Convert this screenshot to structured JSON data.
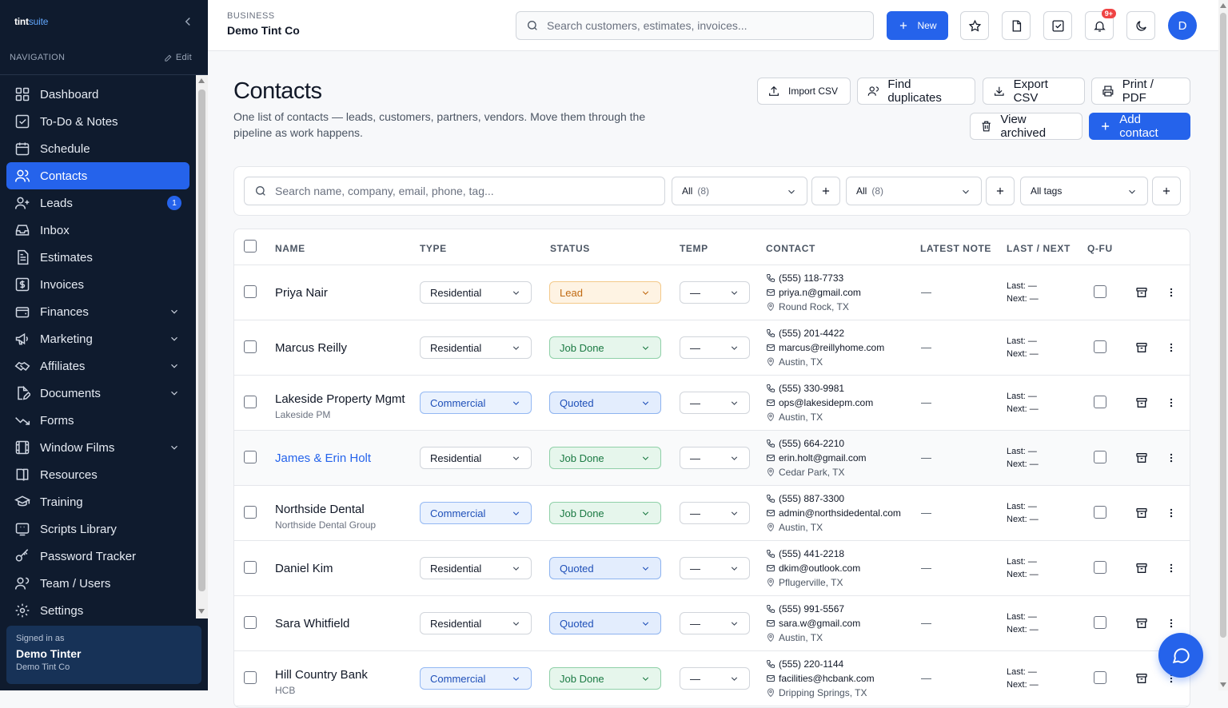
{
  "app": {
    "logo_main": "tint",
    "logo_accent": "suite"
  },
  "sidebar": {
    "nav_heading": "NAVIGATION",
    "edit_label": "Edit",
    "items": [
      {
        "label": "Dashboard",
        "icon": "dashboard-icon"
      },
      {
        "label": "To-Do & Notes",
        "icon": "checkbox-icon"
      },
      {
        "label": "Schedule",
        "icon": "calendar-icon"
      },
      {
        "label": "Contacts",
        "icon": "users-icon",
        "active": true
      },
      {
        "label": "Leads",
        "icon": "user-plus-icon",
        "badge": "1"
      },
      {
        "label": "Inbox",
        "icon": "inbox-icon"
      },
      {
        "label": "Estimates",
        "icon": "document-icon"
      },
      {
        "label": "Invoices",
        "icon": "dollar-icon"
      },
      {
        "label": "Finances",
        "icon": "wallet-icon",
        "expandable": true
      },
      {
        "label": "Marketing",
        "icon": "megaphone-icon",
        "expandable": true
      },
      {
        "label": "Affiliates",
        "icon": "handshake-icon",
        "expandable": true
      },
      {
        "label": "Documents",
        "icon": "file-edit-icon",
        "expandable": true
      },
      {
        "label": "Forms",
        "icon": "trend-icon"
      },
      {
        "label": "Window Films",
        "icon": "film-icon",
        "expandable": true
      },
      {
        "label": "Resources",
        "icon": "book-icon"
      },
      {
        "label": "Training",
        "icon": "graduation-cap-icon"
      },
      {
        "label": "Scripts Library",
        "icon": "script-icon"
      },
      {
        "label": "Password Tracker",
        "icon": "key-icon"
      },
      {
        "label": "Team / Users",
        "icon": "team-icon"
      },
      {
        "label": "Settings",
        "icon": "gear-icon"
      }
    ],
    "signed_in": {
      "label": "Signed in as",
      "name": "Demo Tinter",
      "company": "Demo Tint Co"
    }
  },
  "topbar": {
    "business_label": "BUSINESS",
    "business_name": "Demo Tint Co",
    "search_placeholder": "Search customers, estimates, invoices...",
    "new_label": "New",
    "notif_count": "9+",
    "avatar_initial": "D"
  },
  "page": {
    "title": "Contacts",
    "subtitle": "One list of contacts — leads, customers, partners, vendors. Move them through the pipeline as work happens.",
    "buttons": {
      "import_csv": "Import CSV",
      "find_duplicates": "Find duplicates",
      "export_csv": "Export CSV",
      "print_pdf": "Print / PDF",
      "view_archived": "View archived",
      "add_contact": "Add contact"
    }
  },
  "filters": {
    "search_placeholder": "Search name, company, email, phone, tag...",
    "type_filter": {
      "value": "All",
      "count": "(8)"
    },
    "status_filter": {
      "value": "All",
      "count": "(8)"
    },
    "tags_filter": {
      "value": "All tags"
    }
  },
  "table": {
    "columns": [
      "NAME",
      "TYPE",
      "STATUS",
      "TEMP",
      "CONTACT",
      "LATEST NOTE",
      "LAST / NEXT",
      "Q-FU"
    ],
    "rows": [
      {
        "name": "Priya Nair",
        "company": "",
        "type": "Residential",
        "status": "Lead",
        "temp": "—",
        "phone": "(555) 118-7733",
        "email": "priya.n@gmail.com",
        "location": "Round Rock, TX",
        "note": "—",
        "last": "Last: —",
        "next": "Next: —"
      },
      {
        "name": "Marcus Reilly",
        "company": "",
        "type": "Residential",
        "status": "Job Done",
        "temp": "—",
        "phone": "(555) 201-4422",
        "email": "marcus@reillyhome.com",
        "location": "Austin, TX",
        "note": "—",
        "last": "Last: —",
        "next": "Next: —"
      },
      {
        "name": "Lakeside Property Mgmt",
        "company": "Lakeside PM",
        "type": "Commercial",
        "status": "Quoted",
        "temp": "—",
        "phone": "(555) 330-9981",
        "email": "ops@lakesidepm.com",
        "location": "Austin, TX",
        "note": "—",
        "last": "Last: —",
        "next": "Next: —"
      },
      {
        "name": "James & Erin Holt",
        "company": "",
        "type": "Residential",
        "status": "Job Done",
        "temp": "—",
        "phone": "(555) 664-2210",
        "email": "erin.holt@gmail.com",
        "location": "Cedar Park, TX",
        "note": "—",
        "last": "Last: —",
        "next": "Next: —",
        "hover": true
      },
      {
        "name": "Northside Dental",
        "company": "Northside Dental Group",
        "type": "Commercial",
        "status": "Job Done",
        "temp": "—",
        "phone": "(555) 887-3300",
        "email": "admin@northsidedental.com",
        "location": "Austin, TX",
        "note": "—",
        "last": "Last: —",
        "next": "Next: —"
      },
      {
        "name": "Daniel Kim",
        "company": "",
        "type": "Residential",
        "status": "Quoted",
        "temp": "—",
        "phone": "(555) 441-2218",
        "email": "dkim@outlook.com",
        "location": "Pflugerville, TX",
        "note": "—",
        "last": "Last: —",
        "next": "Next: —"
      },
      {
        "name": "Sara Whitfield",
        "company": "",
        "type": "Residential",
        "status": "Quoted",
        "temp": "—",
        "phone": "(555) 991-5567",
        "email": "sara.w@gmail.com",
        "location": "Austin, TX",
        "note": "—",
        "last": "Last: —",
        "next": "Next: —"
      },
      {
        "name": "Hill Country Bank",
        "company": "HCB",
        "type": "Commercial",
        "status": "Job Done",
        "temp": "—",
        "phone": "(555) 220-1144",
        "email": "facilities@hcbank.com",
        "location": "Dripping Springs, TX",
        "note": "—",
        "last": "Last: —",
        "next": "Next: —"
      }
    ]
  },
  "colors": {
    "accent": "#2563eb",
    "sidebar_bg": "#0f1b2e",
    "notif_badge": "#ef4444"
  }
}
